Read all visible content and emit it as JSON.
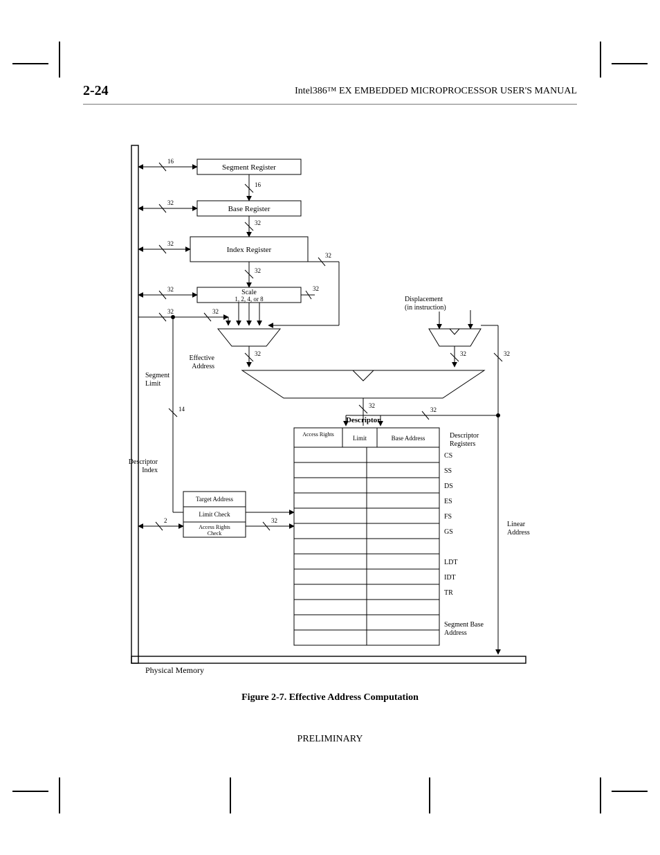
{
  "header": {
    "left": "2-24",
    "right": "Intel386™ EX EMBEDDED MICROPROCESSOR USER'S MANUAL"
  },
  "caption": "Figure 2-7.  Effective Address Computation",
  "footer": "PRELIMINARY",
  "busWidths": {
    "segmentReg": "16",
    "baseReg": "32",
    "indexReg": "32",
    "scale": "32",
    "displacement": "32",
    "effAddr": "32",
    "descrIndex": "14",
    "segLimit": "32",
    "linAddr": "32",
    "protUnit": "2"
  },
  "inputs": {
    "segmentReg": {
      "label": "Segment Register",
      "busw": "16"
    },
    "baseReg": {
      "label": "Base Register",
      "busw": "32"
    },
    "indexReg": {
      "label": "Index Register",
      "busw": "32"
    },
    "scale": {
      "label": "Scale\n1, 2, 4, or 8",
      "busw": "32"
    },
    "displacement": {
      "label": "Displacement\n(in instruction)",
      "busw": "32"
    },
    "protUnit": {
      "label": "Target Address",
      "rows": [
        "Limit Check",
        "Access Rights\nCheck"
      ],
      "busw": "2"
    }
  },
  "nodes": {
    "effAddrLabel": "Effective\nAddress",
    "descrIndex": "Descriptor\nIndex",
    "segLimit": "Segment\nLimit",
    "linAddr": "Linear\nAddress",
    "physMem": "Physical Memory",
    "descrRegTitle": "Descriptor\nRegisters",
    "descrRegCols": [
      "Access Rights",
      "Limit",
      "Base Address"
    ],
    "descrRegRows": [
      "CS",
      "SS",
      "DS",
      "ES",
      "FS",
      "GS",
      "LDT",
      "IDT",
      "TR"
    ],
    "segBaseAddr": "Segment Base\nAddress"
  }
}
